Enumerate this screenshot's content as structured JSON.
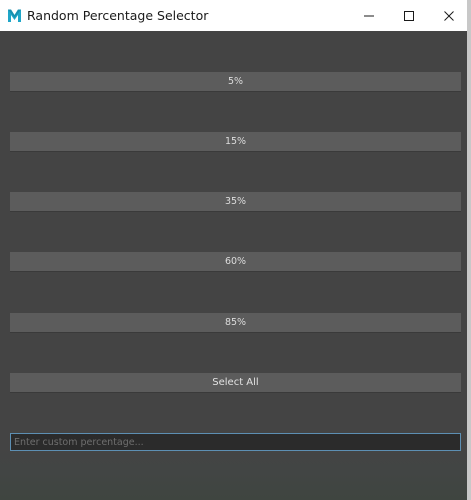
{
  "window": {
    "title": "Random Percentage Selector",
    "app_icon": "maya-m-icon",
    "controls": [
      "minimize-icon",
      "maximize-icon",
      "close-icon"
    ]
  },
  "buttons": [
    {
      "label": "5%"
    },
    {
      "label": "15%"
    },
    {
      "label": "35%"
    },
    {
      "label": "60%"
    },
    {
      "label": "85%"
    }
  ],
  "select_all": {
    "label": "Select All"
  },
  "custom_input": {
    "value": "",
    "placeholder": "Enter custom percentage..."
  },
  "colors": {
    "background": "#444444",
    "button": "#5c5c5c",
    "input_focus_border": "#5d8fb3",
    "icon_accent": "#1fa6c8"
  }
}
